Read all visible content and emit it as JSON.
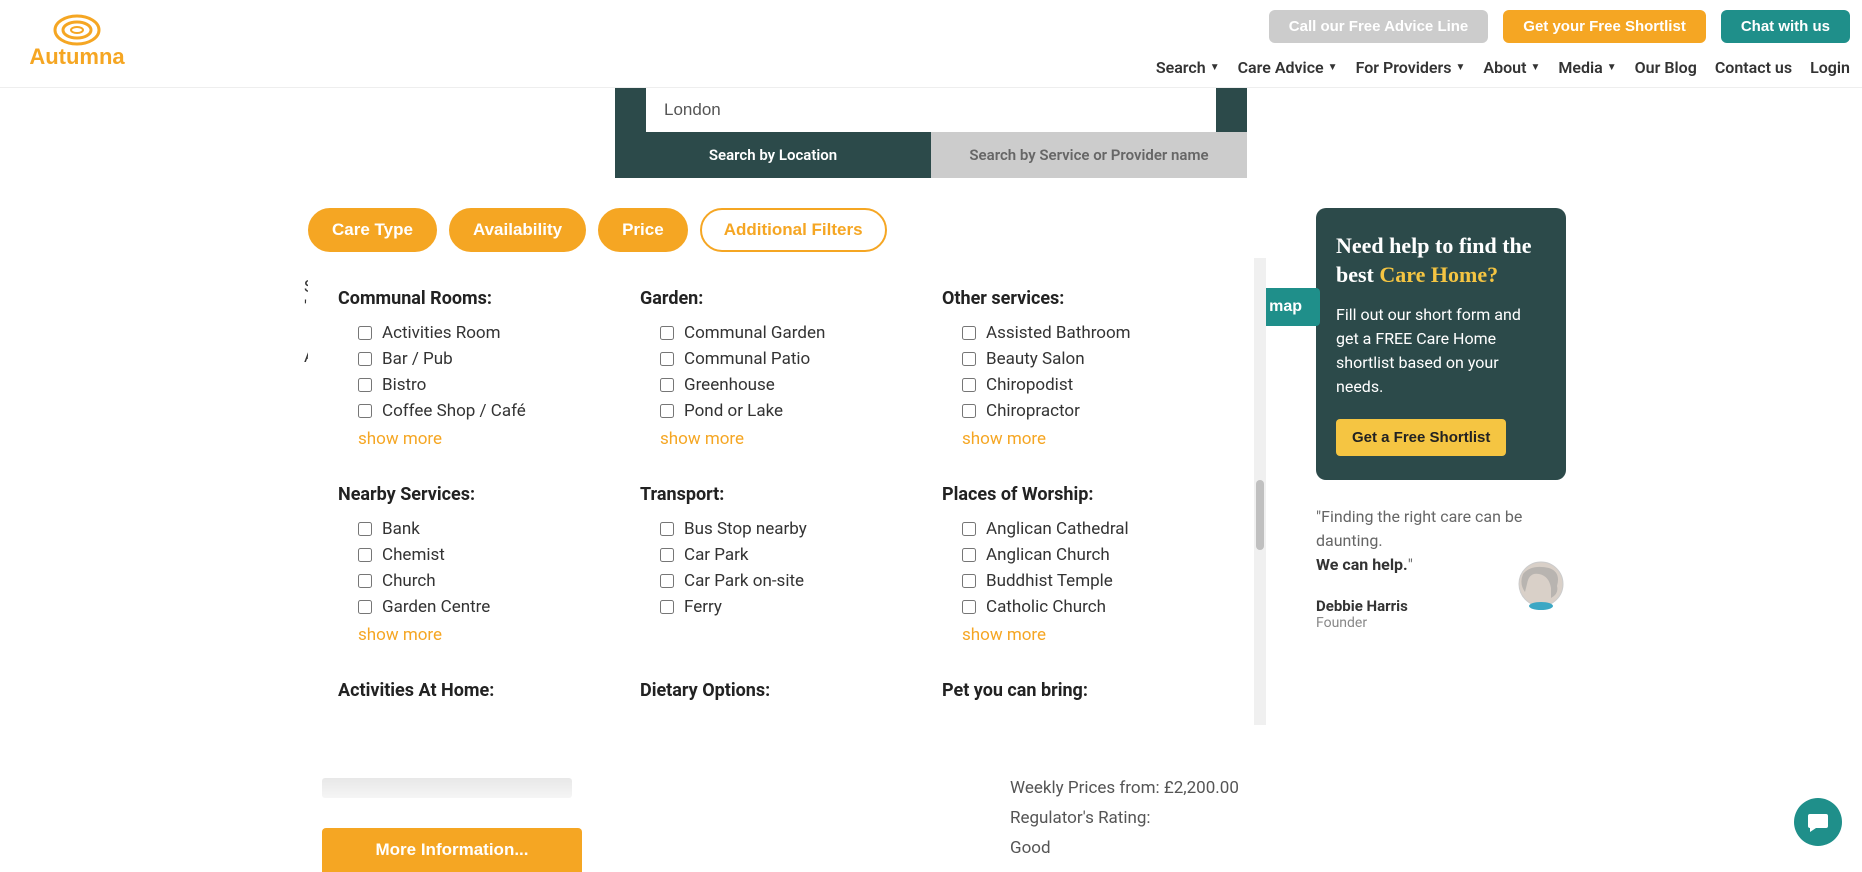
{
  "header": {
    "logo_text": "Autumna",
    "buttons": {
      "advice": "Call our Free Advice Line",
      "shortlist": "Get your Free Shortlist",
      "chat": "Chat with us"
    },
    "nav": [
      "Search",
      "Care Advice",
      "For Providers",
      "About",
      "Media",
      "Our Blog",
      "Contact us",
      "Login"
    ]
  },
  "search": {
    "value": "London",
    "tab_location": "Search by Location",
    "tab_service": "Search by Service or Provider name"
  },
  "filters": {
    "pills": [
      "Care Type",
      "Availability",
      "Price",
      "Additional Filters"
    ]
  },
  "background": {
    "showing_prefix": "Sh",
    "showing_suffix": "'L",
    "applied": "A",
    "map_btn": "map"
  },
  "panel": {
    "show_more": "show more",
    "groups": [
      {
        "heading": "Communal Rooms:",
        "items": [
          "Activities Room",
          "Bar / Pub",
          "Bistro",
          "Coffee Shop / Café"
        ],
        "more": true
      },
      {
        "heading": "Garden:",
        "items": [
          "Communal Garden",
          "Communal Patio",
          "Greenhouse",
          "Pond or Lake"
        ],
        "more": true
      },
      {
        "heading": "Other services:",
        "items": [
          "Assisted Bathroom",
          "Beauty Salon",
          "Chiropodist",
          "Chiropractor"
        ],
        "more": true
      },
      {
        "heading": "Nearby Services:",
        "items": [
          "Bank",
          "Chemist",
          "Church",
          "Garden Centre"
        ],
        "more": true
      },
      {
        "heading": "Transport:",
        "items": [
          "Bus Stop nearby",
          "Car Park",
          "Car Park on-site",
          "Ferry"
        ],
        "more": false
      },
      {
        "heading": "Places of Worship:",
        "items": [
          "Anglican Cathedral",
          "Anglican Church",
          "Buddhist Temple",
          "Catholic Church"
        ],
        "more": true
      },
      {
        "heading": "Activities At Home:",
        "items": [],
        "more": false
      },
      {
        "heading": "Dietary Options:",
        "items": [],
        "more": false
      },
      {
        "heading": "Pet you can bring:",
        "items": [],
        "more": false
      }
    ]
  },
  "result": {
    "price": "Weekly Prices from: £2,200.00",
    "rating_label": "Regulator's Rating:",
    "rating_value": "Good",
    "more_info": "More Information..."
  },
  "sidebar": {
    "help_line1": "Need help to find the best",
    "help_line2": "Care Home?",
    "help_body": "Fill out our short form and get a FREE Care Home shortlist based on your needs.",
    "help_btn": "Get a Free Shortlist",
    "quote1": "\"Finding the right care can be daunting.",
    "quote2": "We can help.",
    "quote_close": "\"",
    "quote_name": "Debbie Harris",
    "quote_role": "Founder"
  }
}
